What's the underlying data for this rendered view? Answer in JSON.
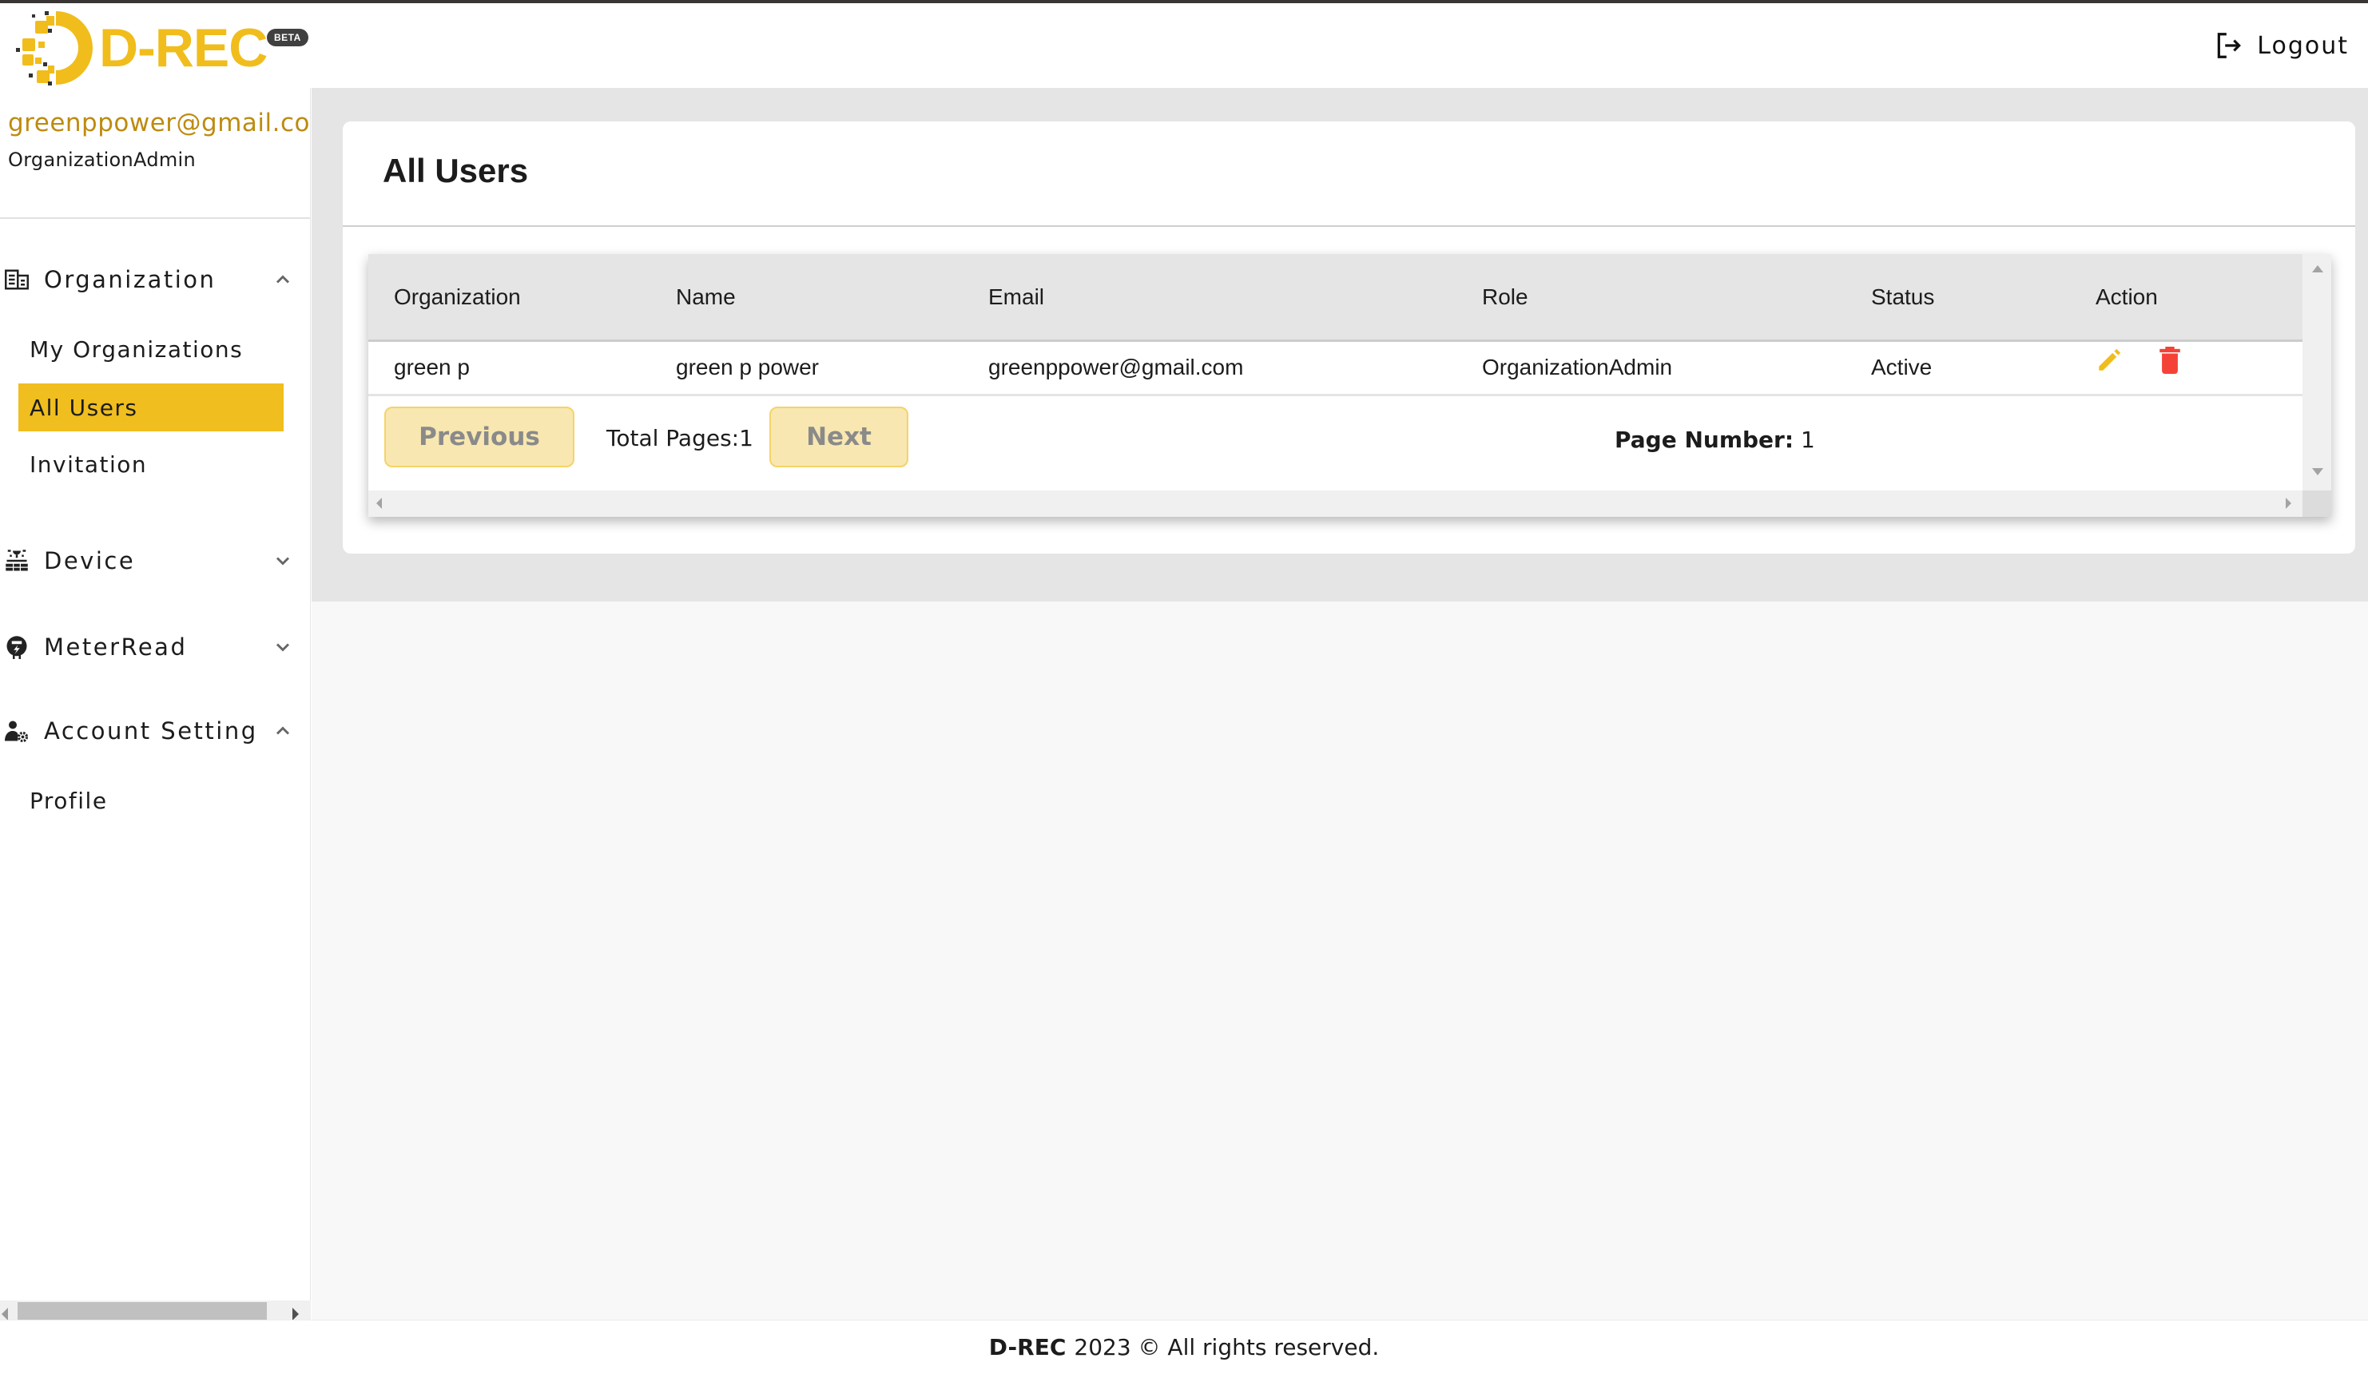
{
  "header": {
    "logo_text": "D-REC",
    "beta_badge": "BETA",
    "logout_label": "Logout",
    "brand_color": "#f0bd1c"
  },
  "sidebar": {
    "user_email": "greenppower@gmail.com",
    "user_role": "OrganizationAdmin",
    "groups": [
      {
        "label": "Organization",
        "icon": "building-icon",
        "expanded": true,
        "items": [
          {
            "label": "My Organizations",
            "active": false
          },
          {
            "label": "All Users",
            "active": true
          },
          {
            "label": "Invitation",
            "active": false
          }
        ]
      },
      {
        "label": "Device",
        "icon": "solar-panel-icon",
        "expanded": false,
        "items": []
      },
      {
        "label": "MeterRead",
        "icon": "meter-icon",
        "expanded": false,
        "items": []
      },
      {
        "label": "Account Setting",
        "icon": "user-gear-icon",
        "expanded": true,
        "items": [
          {
            "label": "Profile",
            "active": false
          }
        ]
      }
    ],
    "active_color": "#f0be1e"
  },
  "main": {
    "title": "All Users",
    "table": {
      "columns": [
        "Organization",
        "Name",
        "Email",
        "Role",
        "Status",
        "Action"
      ],
      "rows": [
        {
          "organization": "green p",
          "name": "green p power",
          "email": "greenppower@gmail.com",
          "role": "OrganizationAdmin",
          "status": "Active",
          "actions": [
            "edit-icon",
            "delete-icon"
          ]
        }
      ]
    },
    "pagination": {
      "previous_label": "Previous",
      "next_label": "Next",
      "total_pages_label": "Total Pages:",
      "total_pages": "1",
      "page_number_label": "Page Number:",
      "page_number": "1"
    }
  },
  "footer": {
    "brand": "D-REC",
    "text": "2023 © All rights reserved."
  }
}
